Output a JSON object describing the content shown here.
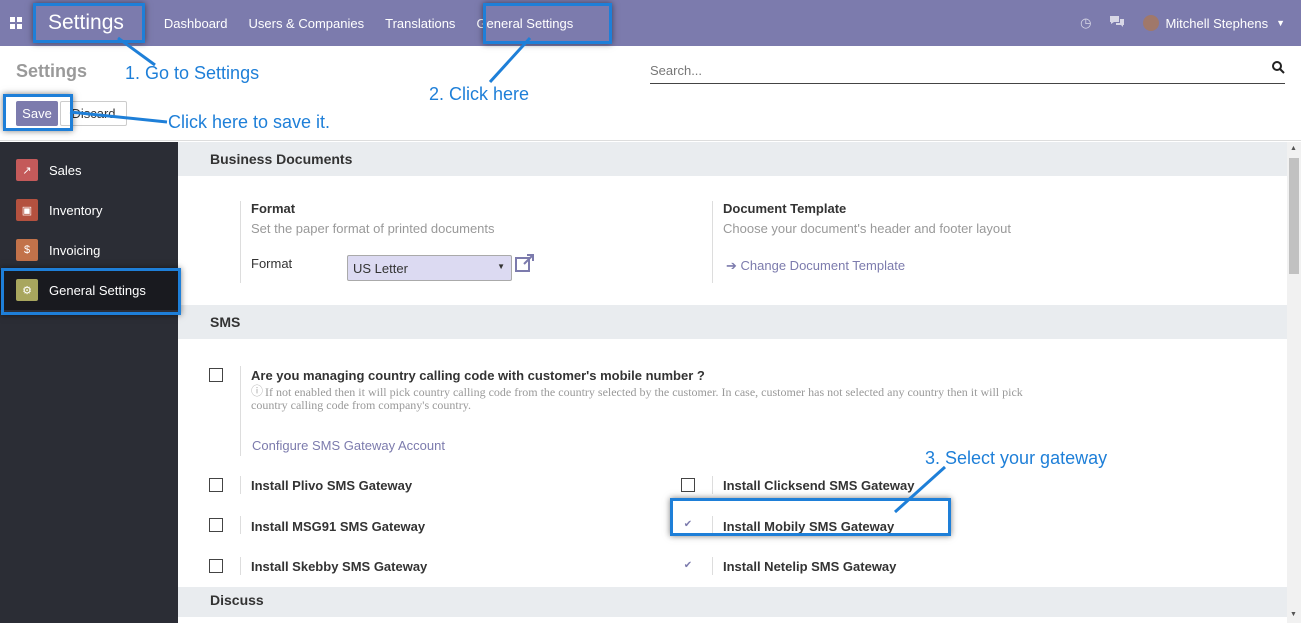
{
  "navbar": {
    "brand": "Settings",
    "menu": [
      "Dashboard",
      "Users & Companies",
      "Translations",
      "General Settings"
    ],
    "clock_icon": "◷",
    "chat_icon": "💬",
    "user_name": "Mitchell Stephens"
  },
  "control_panel": {
    "title": "Settings",
    "search_placeholder": "Search...",
    "save_label": "Save",
    "discard_label": "Discard"
  },
  "sidebar": {
    "items": [
      {
        "label": "Sales",
        "icon": "sales-icon",
        "color": "#c45a5a",
        "glyph": "↗"
      },
      {
        "label": "Inventory",
        "icon": "inventory-icon",
        "color": "#b4513f",
        "glyph": "▣"
      },
      {
        "label": "Invoicing",
        "icon": "invoicing-icon",
        "color": "#c2724a",
        "glyph": "$"
      },
      {
        "label": "General Settings",
        "icon": "gear-icon",
        "color": "#a8a65e",
        "glyph": "⚙"
      }
    ]
  },
  "business_documents": {
    "title": "Business Documents",
    "format_heading": "Format",
    "format_desc": "Set the paper format of printed documents",
    "format_label": "Format",
    "format_value": "US Letter",
    "template_heading": "Document Template",
    "template_desc": "Choose your document's header and footer layout",
    "template_link": "Change Document Template"
  },
  "sms": {
    "title": "SMS",
    "country_code_label": "Are you managing country calling code with customer's mobile number ?",
    "country_code_help_1": "If not enabled then it will pick country calling code from the country selected by the customer. In case, customer has not selected any country then it will pick",
    "country_code_help_2": "country calling code from company's country.",
    "configure_link": "Configure SMS Gateway Account",
    "gateways": [
      {
        "label": "Install Plivo SMS Gateway",
        "checked": false
      },
      {
        "label": "Install Clicksend SMS Gateway",
        "checked": false
      },
      {
        "label": "Install MSG91 SMS Gateway",
        "checked": false
      },
      {
        "label": "Install Mobily SMS Gateway",
        "checked": true
      },
      {
        "label": "Install Skebby SMS Gateway",
        "checked": false
      },
      {
        "label": "Install Netelip SMS Gateway",
        "checked": true
      }
    ]
  },
  "discuss": {
    "title": "Discuss"
  },
  "annotations": {
    "step1": "1. Go to Settings",
    "step2": "2. Click here",
    "step3": "3. Select your gateway",
    "save_note": "Click here to save it."
  },
  "colors": {
    "navbar": "#7c7bad",
    "sidebar": "#2b2d35",
    "annotation": "#1e7fd8",
    "link": "#7c7bad"
  }
}
